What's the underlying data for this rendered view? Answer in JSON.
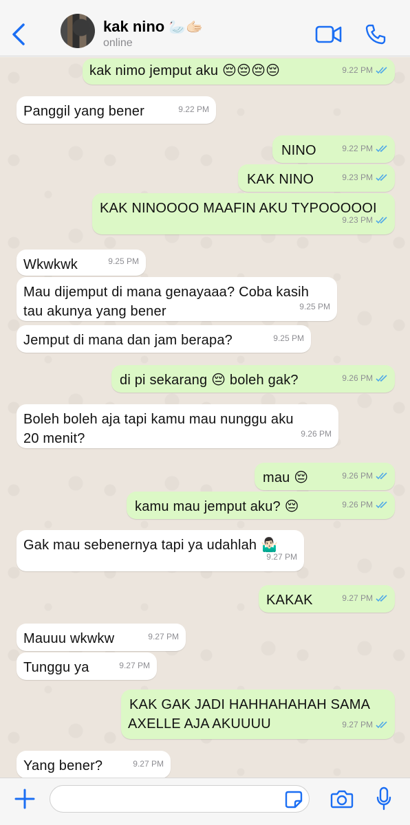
{
  "header": {
    "contact_name": "kak nino",
    "contact_emoji": "🦢🫱🏻",
    "status": "online"
  },
  "messages": [
    {
      "dir": "out",
      "text": "kak nimo jemput aku 😔😔😔😔",
      "time": "9.22 PM"
    },
    {
      "dir": "in",
      "text": "Panggil yang bener",
      "time": "9.22 PM"
    },
    {
      "dir": "out",
      "text": "NINO",
      "time": "9.22 PM"
    },
    {
      "dir": "out",
      "text": "KAK NINO",
      "time": "9.23 PM"
    },
    {
      "dir": "out",
      "text": "KAK NINOOOO MAAFIN AKU TYPOOOOOI",
      "time": "9.23 PM"
    },
    {
      "dir": "in",
      "text": "Wkwkwk",
      "time": "9.25 PM"
    },
    {
      "dir": "in",
      "text": "Mau dijemput di mana genayaaa? Coba kasih tau akunya yang bener",
      "time": "9.25 PM"
    },
    {
      "dir": "in",
      "text": "Jemput di mana dan jam berapa?",
      "time": "9.25 PM"
    },
    {
      "dir": "out",
      "text": "di pi sekarang 😔 boleh gak?",
      "time": "9.26 PM"
    },
    {
      "dir": "in",
      "text": "Boleh boleh aja tapi kamu mau nunggu aku 20 menit?",
      "time": "9.26 PM"
    },
    {
      "dir": "out",
      "text": "mau 😔",
      "time": "9.26 PM"
    },
    {
      "dir": "out",
      "text": "kamu mau jemput aku? 😔",
      "time": "9.26 PM"
    },
    {
      "dir": "in",
      "text": "Gak mau sebenernya tapi ya udahlah 🤷🏻‍♂️",
      "time": "9.27 PM"
    },
    {
      "dir": "out",
      "text": "KAKAK",
      "time": "9.27 PM"
    },
    {
      "dir": "in",
      "text": "Mauuu wkwkw",
      "time": "9.27 PM"
    },
    {
      "dir": "in",
      "text": "Tunggu ya",
      "time": "9.27 PM"
    },
    {
      "dir": "out",
      "text": "KAK GAK JADI HAHHAHAHAH SAMA AXELLE AJA AKUUUU",
      "time": "9.27 PM"
    },
    {
      "dir": "in",
      "text": "Yang bener?",
      "time": "9.27 PM"
    }
  ],
  "input": {
    "value": "",
    "placeholder": ""
  },
  "colors": {
    "accent": "#1b6ef3",
    "outgoing_bubble": "#dcf8c6",
    "incoming_bubble": "#ffffff",
    "read_check": "#4fa8e8"
  },
  "icons": [
    "back-chevron-icon",
    "video-call-icon",
    "phone-icon",
    "plus-icon",
    "sticker-icon",
    "camera-icon",
    "microphone-icon"
  ]
}
